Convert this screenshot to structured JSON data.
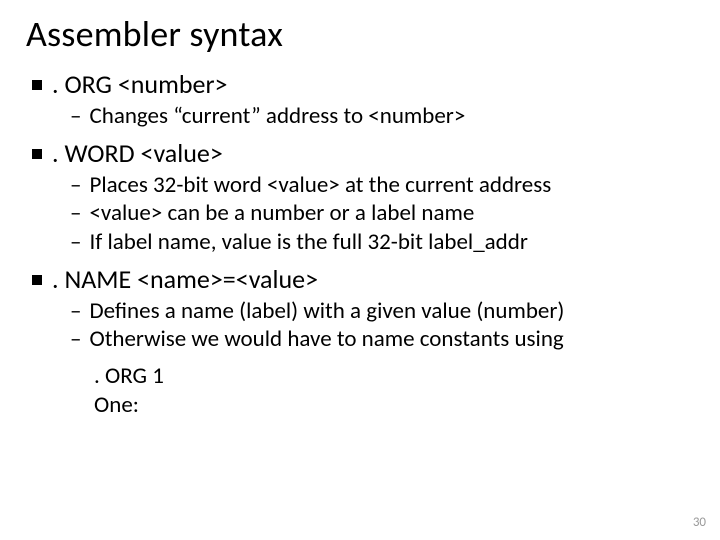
{
  "title": "Assembler syntax",
  "items": [
    {
      "heading": ". ORG <number>",
      "subs": [
        "Changes “current” address to <number>"
      ]
    },
    {
      "heading": ". WORD <value>",
      "subs": [
        "Places 32-bit word <value> at the current address",
        "<value> can be a number or a label name",
        "If label name, value is the full 32-bit label_addr"
      ]
    },
    {
      "heading": ". NAME <name>=<value>",
      "subs": [
        "Defines a name (label) with a given value (number)",
        "Otherwise we would have to name constants using"
      ],
      "code": [
        ". ORG 1",
        "One:"
      ]
    }
  ],
  "page_number": "30"
}
